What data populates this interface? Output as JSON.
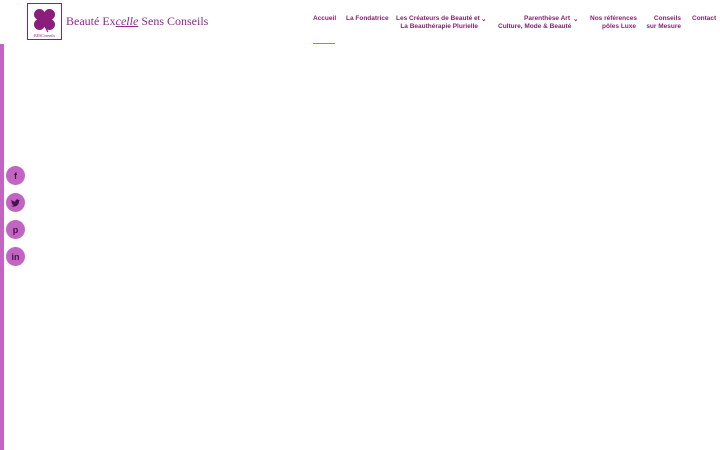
{
  "brand": {
    "title_prefix": "Beauté Ex",
    "title_em": "celle",
    "title_suffix": " Sens Conseils",
    "logo_caption": "BESConseils"
  },
  "nav": {
    "items": [
      {
        "line1": "Accueil",
        "line2": ""
      },
      {
        "line1": "La Fondatrice",
        "line2": ""
      },
      {
        "line1": "Les Créateurs de Beauté et",
        "line2": "La Beauthérapie Plurielle"
      },
      {
        "line1": "Parenthèse Art",
        "line2": "Culture, Mode & Beauté"
      },
      {
        "line1": "Nos références",
        "line2": "pôles Luxe"
      },
      {
        "line1": "Conseils",
        "line2": "sur Mesure"
      },
      {
        "line1": "Contact",
        "line2": ""
      }
    ]
  },
  "social": {
    "facebook": "f",
    "twitter": "t",
    "pinterest": "p",
    "linkedin": "in"
  },
  "colors": {
    "accent": "#c264c2",
    "nav_text": "#8b1e6d",
    "brand_text": "#8a2a8a"
  }
}
